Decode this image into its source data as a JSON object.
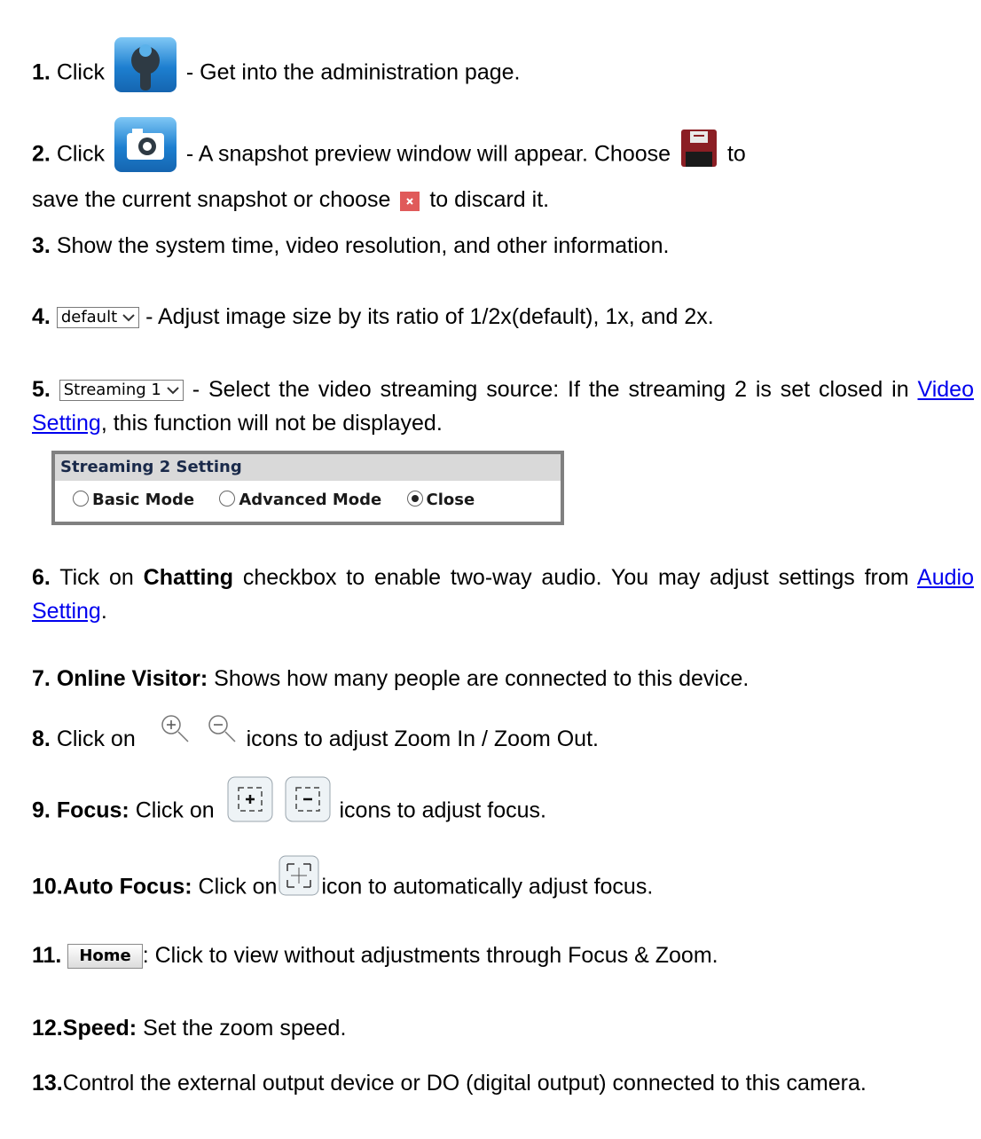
{
  "items": [
    {
      "num": "1.",
      "click": "Click",
      "text": "- Get into the administration page."
    },
    {
      "num": "2.",
      "click": "Click",
      "text_a": "- A snapshot preview window will appear. Choose",
      "text_b": "to",
      "text_c": "save the current snapshot or choose",
      "text_d": "to discard it."
    },
    {
      "num": "3.",
      "text": "Show the system time, video resolution, and other information."
    },
    {
      "num": "4.",
      "dropdown": "default",
      "text": "- Adjust image size by its ratio of 1/2x(default), 1x, and 2x."
    },
    {
      "num": "5.",
      "dropdown": "Streaming 1",
      "text_a": "- Select the video streaming source: If the streaming 2 is set closed in",
      "link": "Video Setting",
      "text_b": ", this function will not be displayed."
    },
    {
      "num": "6.",
      "text_a": "Tick on",
      "bold": "Chatting",
      "text_b": "checkbox to enable two-way audio. You may adjust settings from",
      "link": "Audio Setting",
      "text_c": "."
    },
    {
      "num": "7.",
      "bold": "Online Visitor:",
      "text": "Shows how many people are connected to this device."
    },
    {
      "num": "8.",
      "text_a": "Click on",
      "text_b": "icons to adjust Zoom In / Zoom Out."
    },
    {
      "num": "9.",
      "bold": "Focus:",
      "text_a": "Click on",
      "text_b": "icons to adjust focus."
    },
    {
      "num": "10.",
      "bold": "Auto Focus:",
      "text_a": "Click on",
      "text_b": "icon to automatically adjust focus."
    },
    {
      "num": "11.",
      "button": "Home",
      "text": ": Click to view without adjustments through Focus & Zoom."
    },
    {
      "num": "12.",
      "bold": "Speed:",
      "text": "Set the zoom speed."
    },
    {
      "num": "13.",
      "text": "Control the external output device or DO (digital output) connected to this camera."
    }
  ],
  "panel": {
    "title": "Streaming 2 Setting",
    "options": [
      {
        "label": "Basic Mode",
        "selected": false
      },
      {
        "label": "Advanced Mode",
        "selected": false
      },
      {
        "label": "Close",
        "selected": true
      }
    ]
  },
  "icons": [
    "wrench-icon",
    "camera-icon",
    "save-icon",
    "discard-icon",
    "zoom-in-icon",
    "zoom-out-icon",
    "focus-near-icon",
    "focus-far-icon",
    "auto-focus-icon"
  ]
}
